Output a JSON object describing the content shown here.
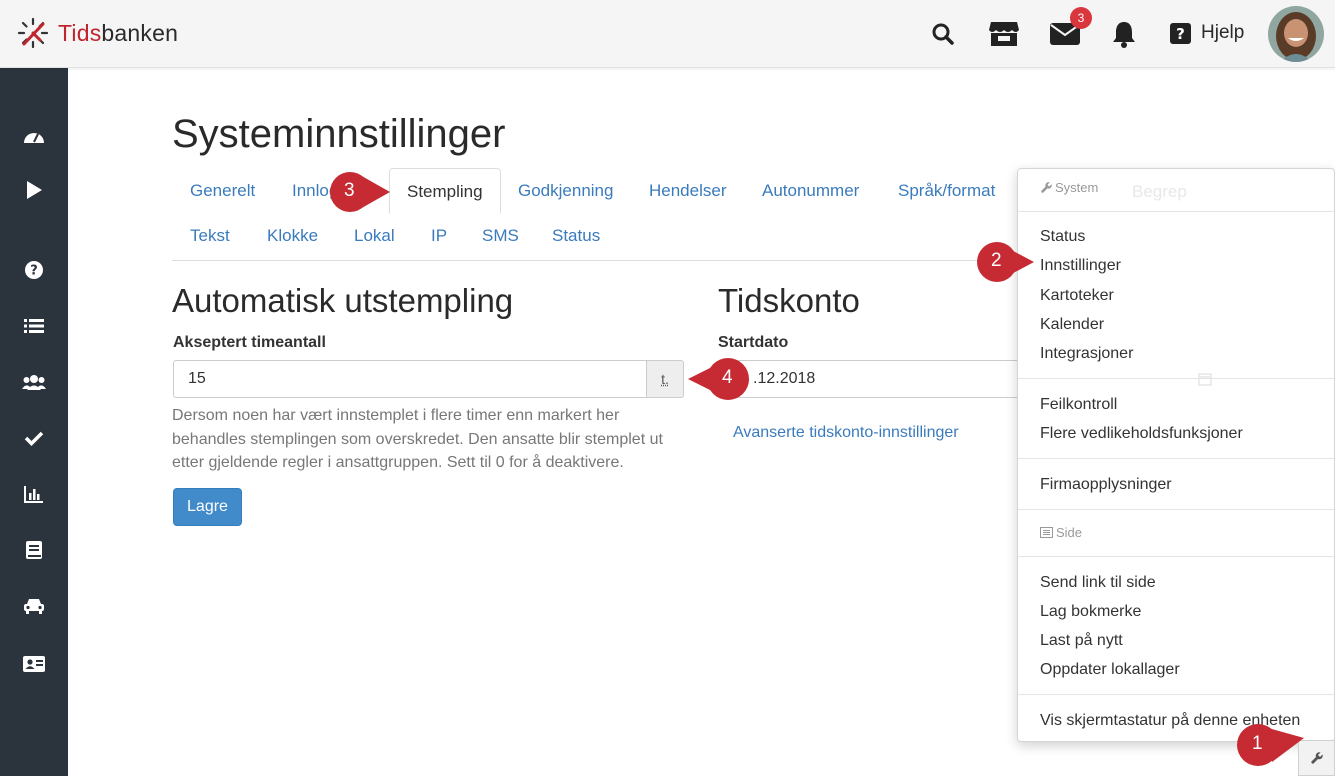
{
  "brand": {
    "name_red": "Tids",
    "name_dark": "banken"
  },
  "topbar": {
    "icons": [
      "search-icon",
      "store-icon",
      "envelope-icon",
      "bell-icon",
      "question-icon"
    ],
    "mail_badge": "3",
    "help_label": "Hjelp"
  },
  "sidebar": {
    "icons": [
      "dashboard-icon",
      "play-icon",
      "question-circle-icon",
      "list-icon",
      "users-icon",
      "check-icon",
      "bar-chart-icon",
      "book-icon",
      "car-icon",
      "id-card-icon"
    ]
  },
  "page": {
    "title": "Systeminnstillinger",
    "tabs_row1": [
      "Generelt",
      "Innlog",
      "Stempling",
      "Godkjenning",
      "Hendelser",
      "Autonummer",
      "Språk/format"
    ],
    "tabs_row2": [
      "Tekst",
      "Klokke",
      "Lokal",
      "IP",
      "SMS",
      "Status"
    ],
    "active_tab": "Stempling",
    "ghost_tab": "Begrep"
  },
  "auto_stamp": {
    "heading": "Automatisk utstempling",
    "label": "Akseptert timeantall",
    "value": "15",
    "unit": "t.",
    "help": "Dersom noen har vært innstemplet i flere timer enn markert her behandles stemplingen som overskredet. Den ansatte blir stemplet ut etter gjeldende regler i ansattgruppen. Sett til 0 for å deaktivere.",
    "save": "Lagre"
  },
  "time_account": {
    "heading": "Tidskonto",
    "label": "Startdato",
    "value": ".12.2018",
    "link": "Avanserte tidskonto-innstillinger"
  },
  "dropdown": {
    "system_header": "System",
    "group1": [
      "Status",
      "Innstillinger",
      "Kartoteker",
      "Kalender",
      "Integrasjoner"
    ],
    "group2": [
      "Feilkontroll",
      "Flere vedlikeholdsfunksjoner"
    ],
    "group3": [
      "Firmaopplysninger"
    ],
    "side_header": "Side",
    "group4": [
      "Send link til side",
      "Lag bokmerke",
      "Last på nytt",
      "Oppdater lokallager"
    ],
    "group5": [
      "Vis skjermtastatur på denne enheten"
    ]
  },
  "annotations": [
    "1",
    "2",
    "3",
    "4"
  ],
  "colors": {
    "accent": "#3a7bbd",
    "sidebar": "#2b333d",
    "marker": "#c62a33",
    "button": "#428bca"
  }
}
